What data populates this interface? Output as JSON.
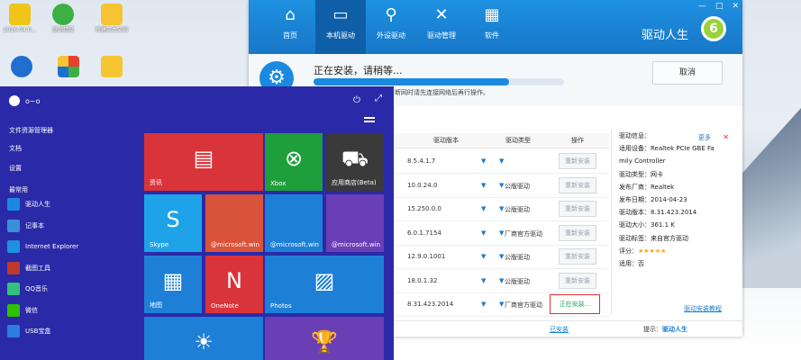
{
  "desktop": {
    "icons": [
      {
        "label": "2016-04-0...",
        "color": "#f0c419"
      },
      {
        "label": "驱动精灵",
        "color": "#3cb043"
      },
      {
        "label": "新建文本文档",
        "color": "#f7c431"
      },
      {
        "label": "",
        "color": "#1e6fd0"
      },
      {
        "label": "",
        "color": "#e8422f"
      },
      {
        "label": "",
        "color": "#f7c431"
      }
    ]
  },
  "app": {
    "nav": [
      {
        "icon": "home-icon",
        "glyph": "⌂",
        "label": "首页"
      },
      {
        "icon": "monitor-icon",
        "glyph": "▭",
        "label": "本机驱动"
      },
      {
        "icon": "usb-icon",
        "glyph": "⚲",
        "label": "外设驱动"
      },
      {
        "icon": "tools-icon",
        "glyph": "✕",
        "label": "驱动管理"
      },
      {
        "icon": "apps-icon",
        "glyph": "▦",
        "label": "软件"
      }
    ],
    "brand": "驱动人生",
    "logo_glyph": "6",
    "window_controls": [
      "—",
      "□",
      "✕"
    ],
    "status": {
      "title": "正在安装，请稍等...",
      "progress": 0.78,
      "subtitle": "断网时请先连接网络后再行操作。",
      "cancel": "取消"
    },
    "table": {
      "headers": [
        "驱动版本",
        "驱动类型",
        "操作"
      ],
      "rows": [
        {
          "name": "",
          "version": "8.5.4.1.7",
          "type": "",
          "action": "重新安装"
        },
        {
          "name": "",
          "version": "10.0.24.0",
          "type": "公版驱动",
          "action": "重新安装"
        },
        {
          "name": "",
          "version": "15.250.0.0",
          "type": "公版驱动",
          "action": "重新安装"
        },
        {
          "name": "",
          "version": "6.0.1.7154",
          "type": "厂商官方驱动",
          "action": "重新安装"
        },
        {
          "name": "",
          "version": "12.9.0.1001",
          "type": "公版驱动",
          "action": "重新安装"
        },
        {
          "name": "",
          "version": "18.0.1.32",
          "type": "公版驱动",
          "action": "重新安装"
        },
        {
          "name": "",
          "version": "8.31.423.2014",
          "type": "厂商官方驱动",
          "action": "正在安装..."
        }
      ]
    },
    "detail": {
      "more": "更多",
      "close": "✕",
      "lines": [
        "驱动信息：",
        "适用设备：Realtek PCIe GBE Fa",
        "mily Controller",
        "驱动类型：网卡",
        "发布厂商：Realtek",
        "发布日期：2014-04-23",
        "驱动版本：8.31.423.2014",
        "驱动大小：361.1 K",
        "驱动标签：来自官方驱动",
        "评分：",
        "适用：否"
      ],
      "stars": "★★★★★",
      "link": "驱动安装教程"
    },
    "footer": {
      "link": "已安装",
      "note": "提示：",
      "note_brand": "驱动人生"
    }
  },
  "start": {
    "user": "o~o",
    "links": [
      "文件资源管理器",
      "文档",
      "设置"
    ],
    "section": "最常用",
    "apps": [
      {
        "label": "驱动人生",
        "color": "#1a8ae0"
      },
      {
        "label": "记事本",
        "color": "#3a8fd8"
      },
      {
        "label": "Internet Explorer",
        "color": "#1e90e0"
      },
      {
        "label": "截图工具",
        "color": "#c0392b"
      },
      {
        "label": "QQ音乐",
        "color": "#31c27c"
      },
      {
        "label": "微信",
        "color": "#2dc100"
      },
      {
        "label": "USB宝盒",
        "color": "#2a7de1"
      }
    ],
    "tiles": [
      {
        "label": "资讯",
        "glyph": "▤",
        "color": "#d9343a"
      },
      {
        "label": "Xbox",
        "glyph": "⊗",
        "color": "#1f9e3c"
      },
      {
        "label": "应用商店(Beta)",
        "glyph": "⛟",
        "color": "#3a3a3a"
      },
      {
        "label": "Skype",
        "glyph": "S",
        "color": "#1fa3e8"
      },
      {
        "label": "@microsoft.win",
        "glyph": "",
        "color": "#d9533a"
      },
      {
        "label": "@microsoft.win",
        "glyph": "",
        "color": "#1e7fd6"
      },
      {
        "label": "@microsoft.win",
        "glyph": "",
        "color": "#6a3fb5"
      },
      {
        "label": "地图",
        "glyph": "▦",
        "color": "#1e7fd6"
      },
      {
        "label": "OneNote",
        "glyph": "N",
        "color": "#d9343a"
      },
      {
        "label": "Photos",
        "glyph": "▨",
        "color": "#1e7fd6"
      },
      {
        "label": "",
        "glyph": "☀",
        "color": "#1e7fd6"
      },
      {
        "label": "",
        "glyph": "🏆",
        "color": "#6a3fb5"
      }
    ]
  }
}
